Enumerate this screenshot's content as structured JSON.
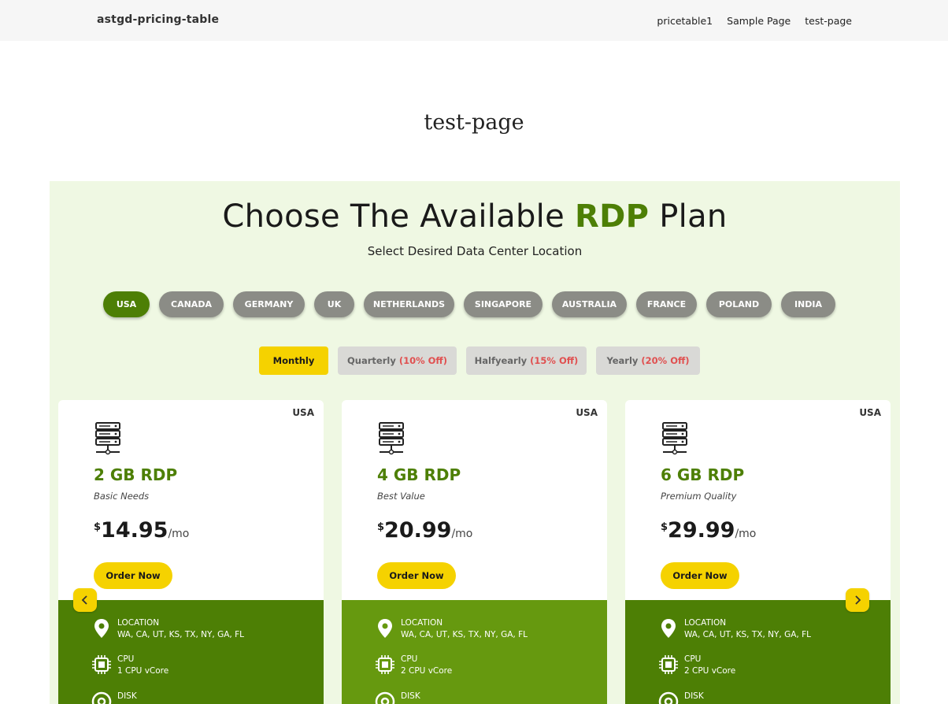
{
  "header": {
    "site_title": "astgd-pricing-table",
    "nav": [
      "pricetable1",
      "Sample Page",
      "test-page"
    ]
  },
  "page_title": "test-page",
  "section": {
    "heading_pre": "Choose The Available",
    "heading_highlight": "RDP",
    "heading_post": "Plan",
    "subheading": "Select Desired Data Center Location"
  },
  "locations": [
    {
      "label": "USA",
      "active": true
    },
    {
      "label": "CANADA",
      "active": false
    },
    {
      "label": "GERMANY",
      "active": false
    },
    {
      "label": "UK",
      "active": false
    },
    {
      "label": "NETHERLANDS",
      "active": false
    },
    {
      "label": "SINGAPORE",
      "active": false
    },
    {
      "label": "AUSTRALIA",
      "active": false
    },
    {
      "label": "FRANCE",
      "active": false
    },
    {
      "label": "POLAND",
      "active": false
    },
    {
      "label": "INDIA",
      "active": false
    }
  ],
  "periods": [
    {
      "label": "Monthly",
      "discount": "",
      "active": true
    },
    {
      "label": "Quarterly",
      "discount": "(10% Off)",
      "active": false
    },
    {
      "label": "Halfyearly",
      "discount": "(15% Off)",
      "active": false
    },
    {
      "label": "Yearly",
      "discount": "(20% Off)",
      "active": false
    }
  ],
  "plans": [
    {
      "country": "USA",
      "name": "2 GB RDP",
      "desc": "Basic Needs",
      "currency": "$",
      "price": "14.95",
      "per": "/mo",
      "order_label": "Order Now",
      "specs": [
        {
          "icon": "location-pin-icon",
          "name": "LOCATION",
          "value": "WA, CA, UT, KS, TX, NY, GA, FL"
        },
        {
          "icon": "cpu-icon",
          "name": "CPU",
          "value": "1 CPU vCore"
        },
        {
          "icon": "disk-icon",
          "name": "DISK",
          "value": ""
        }
      ]
    },
    {
      "country": "USA",
      "name": "4 GB RDP",
      "desc": "Best Value",
      "currency": "$",
      "price": "20.99",
      "per": "/mo",
      "order_label": "Order Now",
      "specs": [
        {
          "icon": "location-pin-icon",
          "name": "LOCATION",
          "value": "WA, CA, UT, KS, TX, NY, GA, FL"
        },
        {
          "icon": "cpu-icon",
          "name": "CPU",
          "value": "2 CPU vCore"
        },
        {
          "icon": "disk-icon",
          "name": "DISK",
          "value": ""
        }
      ]
    },
    {
      "country": "USA",
      "name": "6 GB RDP",
      "desc": "Premium Quality",
      "currency": "$",
      "price": "29.99",
      "per": "/mo",
      "order_label": "Order Now",
      "specs": [
        {
          "icon": "location-pin-icon",
          "name": "LOCATION",
          "value": "WA, CA, UT, KS, TX, NY, GA, FL"
        },
        {
          "icon": "cpu-icon",
          "name": "CPU",
          "value": "2 CPU vCore"
        },
        {
          "icon": "disk-icon",
          "name": "DISK",
          "value": ""
        }
      ]
    }
  ],
  "colors": {
    "accent_green": "#4d7f05",
    "featured_green": "#66990f",
    "accent_yellow": "#f5d200",
    "panel_bg": "#eff8e3",
    "discount_red": "#e05050"
  }
}
